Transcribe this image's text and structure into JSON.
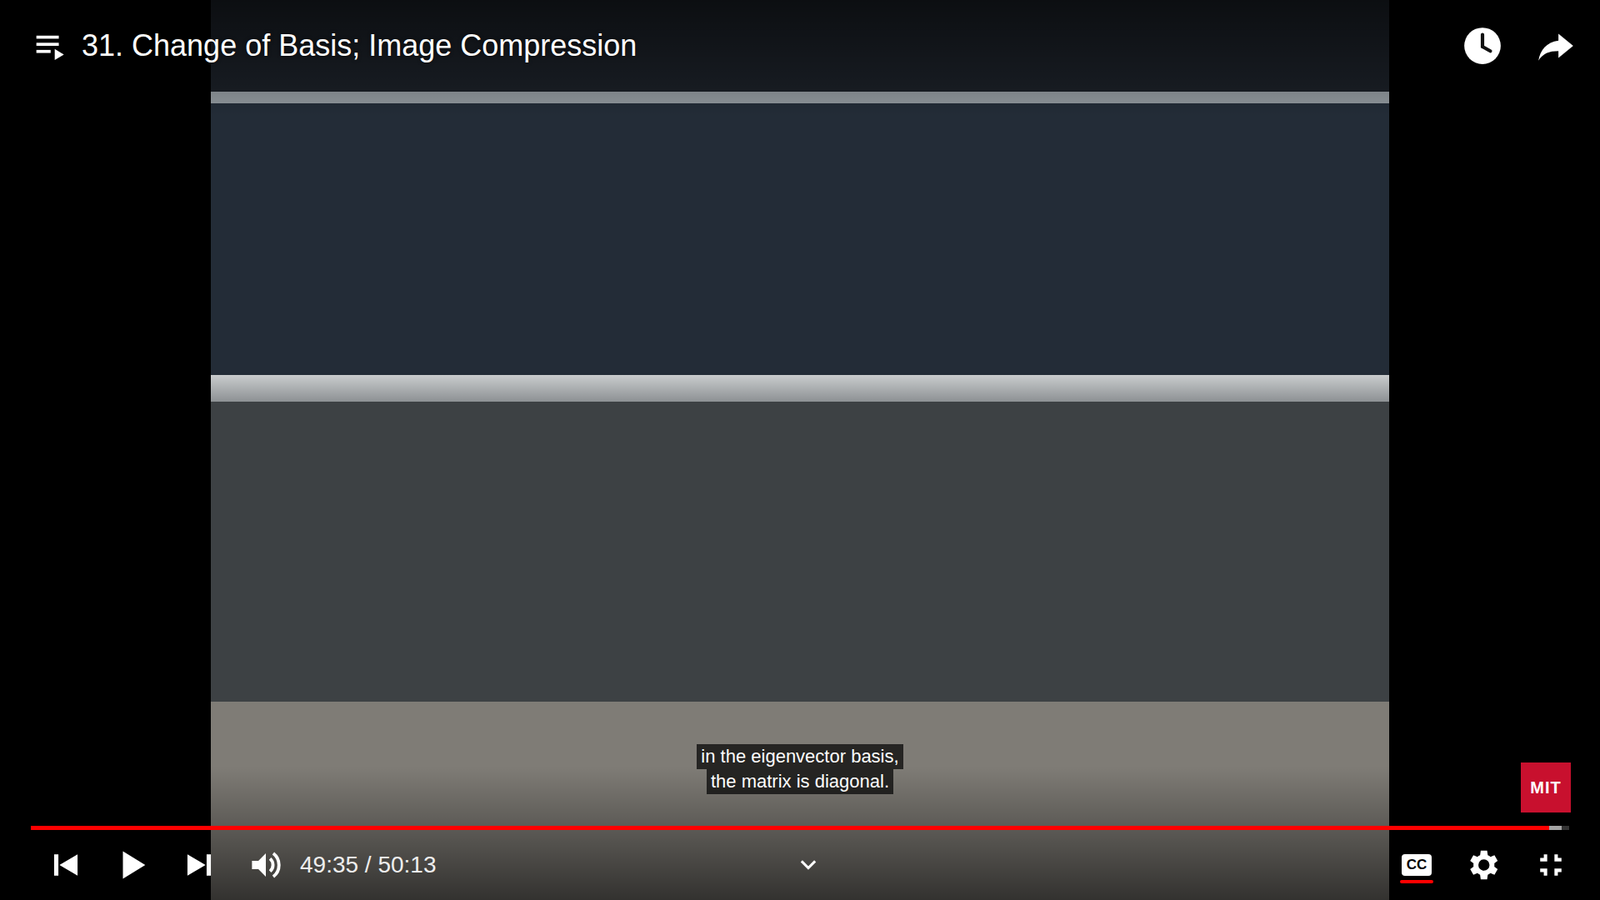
{
  "video": {
    "title": "31. Change of Basis; Image Compression",
    "playing": false,
    "captions_on": true,
    "caption_lines": [
      "in the eigenvector basis,",
      "the matrix is diagonal."
    ],
    "watermark": "MIT"
  },
  "progress": {
    "level": 0.987,
    "buffered": 0.995
  },
  "time": {
    "display": "49:35 / 50:13"
  },
  "controls": {
    "cc_label": "CC"
  }
}
